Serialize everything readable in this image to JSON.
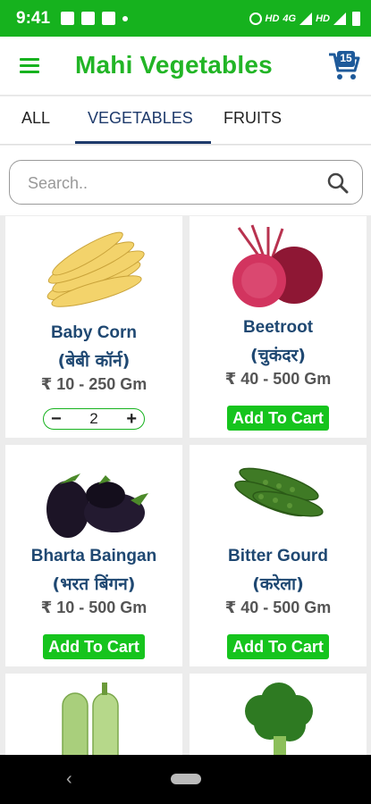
{
  "status_bar": {
    "time": "9:41",
    "network": "HD",
    "network2": "4G",
    "network3": "HD"
  },
  "app_bar": {
    "title": "Mahi Vegetables",
    "cart_count": "15"
  },
  "tabs": [
    {
      "label": "ALL",
      "active": false
    },
    {
      "label": "VEGETABLES",
      "active": true
    },
    {
      "label": "FRUITS",
      "active": false
    }
  ],
  "search": {
    "placeholder": "Search..",
    "value": ""
  },
  "products": [
    {
      "name": "Baby Corn",
      "hindi": "(बेबी कॉर्न)",
      "price": "₹ 10 - 250 Gm",
      "in_cart": true,
      "quantity": "2",
      "minus": "−",
      "plus": "+"
    },
    {
      "name": "Beetroot",
      "hindi": "(चुकंदर)",
      "price": "₹ 40 - 500 Gm",
      "in_cart": false,
      "button": "Add To Cart"
    },
    {
      "name": "Bharta Baingan",
      "hindi": "(भरत बिंगन)",
      "price": "₹ 10 - 500 Gm",
      "in_cart": false,
      "button": "Add To Cart"
    },
    {
      "name": "Bitter Gourd",
      "hindi": "(करेला)",
      "price": "₹ 40 - 500 Gm",
      "in_cart": false,
      "button": "Add To Cart"
    }
  ],
  "colors": {
    "brand_green": "#16b21e",
    "title_green": "#22b526",
    "product_text": "#1f4872",
    "tab_active": "#1e3a6b"
  }
}
